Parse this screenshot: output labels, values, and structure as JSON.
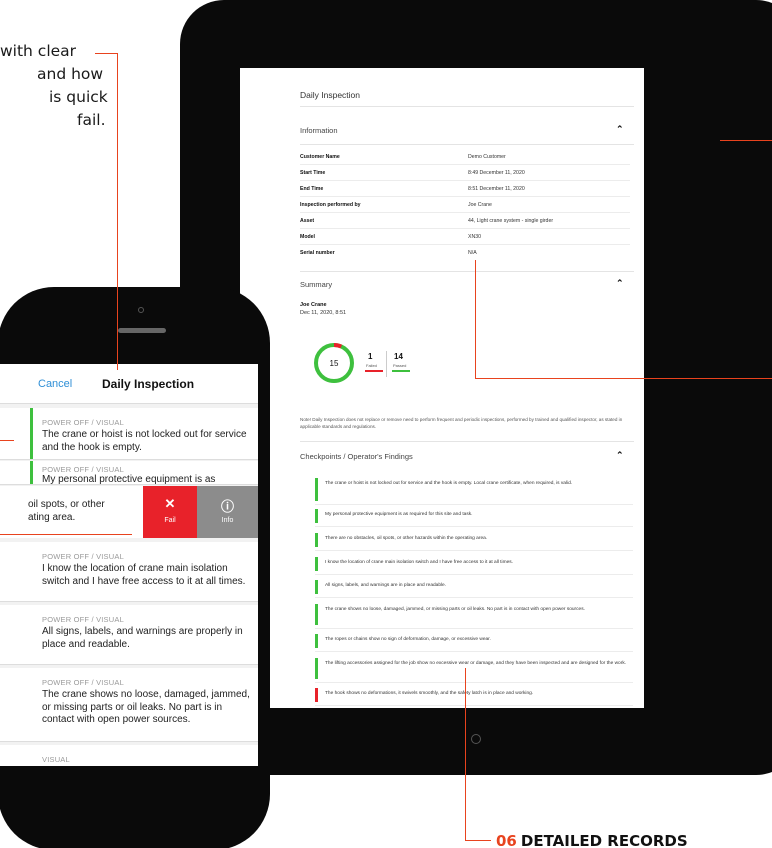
{
  "callouts": {
    "top_left_lines": [
      "with clear",
      "and how",
      "is quick",
      "fail."
    ],
    "bottom": {
      "number": "06",
      "label": "DETAILED RECORDS"
    }
  },
  "colors": {
    "accent": "#e8431e",
    "pass": "#3ec03e",
    "fail": "#e8222a",
    "link": "#2f8fd6"
  },
  "tablet": {
    "title": "Daily Inspection",
    "information": {
      "header": "Information",
      "rows": [
        {
          "key": "Customer Name",
          "value": "Demo Customer"
        },
        {
          "key": "Start Time",
          "value": "8:49 December 11, 2020"
        },
        {
          "key": "End Time",
          "value": "8:51 December 11, 2020"
        },
        {
          "key": "Inspection performed by",
          "value": "Joe Crane"
        },
        {
          "key": "Asset",
          "value": "44, Light crane system - single girder"
        },
        {
          "key": "Model",
          "value": "XN30"
        },
        {
          "key": "Serial number",
          "value": "N/A"
        }
      ]
    },
    "summary": {
      "header": "Summary",
      "inspector": "Joe Crane",
      "date": "Dec 11, 2020, 8:51",
      "total": "15",
      "failed_count": "1",
      "failed_label": "Failed",
      "passed_count": "14",
      "passed_label": "Passed",
      "note": "Note! Daily Inspection does not replace or remove need to perform frequent and periodic inspections, performed by trained and qualified inspector, as stated in applicable standards and regulations."
    },
    "checkpoints": {
      "header": "Checkpoints / Operator's Findings",
      "items": [
        {
          "text": "The crane or hoist is not locked out for service and the hook is empty. Local crane certificate, when required, is valid.",
          "status": "pass"
        },
        {
          "text": "My personal protective equipment is as required for this site and task.",
          "status": "pass"
        },
        {
          "text": "There are no obstacles, oil spots, or other hazards within the operating area.",
          "status": "pass"
        },
        {
          "text": "I know the location of crane main isolation switch and I have free access to it at all times.",
          "status": "pass"
        },
        {
          "text": "All signs, labels, and warnings are in place and readable.",
          "status": "pass"
        },
        {
          "text": "The crane shows no loose, damaged, jammed, or missing parts or oil leaks. No part is in contact with open power sources.",
          "status": "pass"
        },
        {
          "text": "The ropes or chains show no sign of deformation, damage, or excessive wear.",
          "status": "pass"
        },
        {
          "text": "The lifting accessories assigned for the job show no excessive wear or damage, and they have been inspected and are designed for the work.",
          "status": "pass"
        },
        {
          "text": "The hook shows no deformations, it swivels smoothly, and the safety latch is in place and working.",
          "status": "fail"
        }
      ]
    }
  },
  "phone": {
    "cancel_label": "Cancel",
    "title": "Daily Inspection",
    "swipe_row_lines": [
      "oil spots, or other",
      "ating area."
    ],
    "fail_label": "Fail",
    "info_label": "Info",
    "cards": [
      {
        "category": "POWER OFF / VISUAL",
        "text": "The crane or hoist is not locked out for service and the hook is empty."
      },
      {
        "category": "POWER OFF / VISUAL",
        "text": "My personal protective equipment is as instructed for this site and task."
      },
      {
        "category": "POWER OFF / VISUAL",
        "text": "I know the location of crane main isolation switch and I have free access to it at all times."
      },
      {
        "category": "POWER OFF / VISUAL",
        "text": "All signs, labels, and warnings are properly in place and readable."
      },
      {
        "category": "POWER OFF / VISUAL",
        "text": "The crane shows no loose, damaged, jammed, or missing parts or oil leaks. No part is in contact with open power sources."
      },
      {
        "category": "VISUAL",
        "text": ""
      }
    ]
  }
}
